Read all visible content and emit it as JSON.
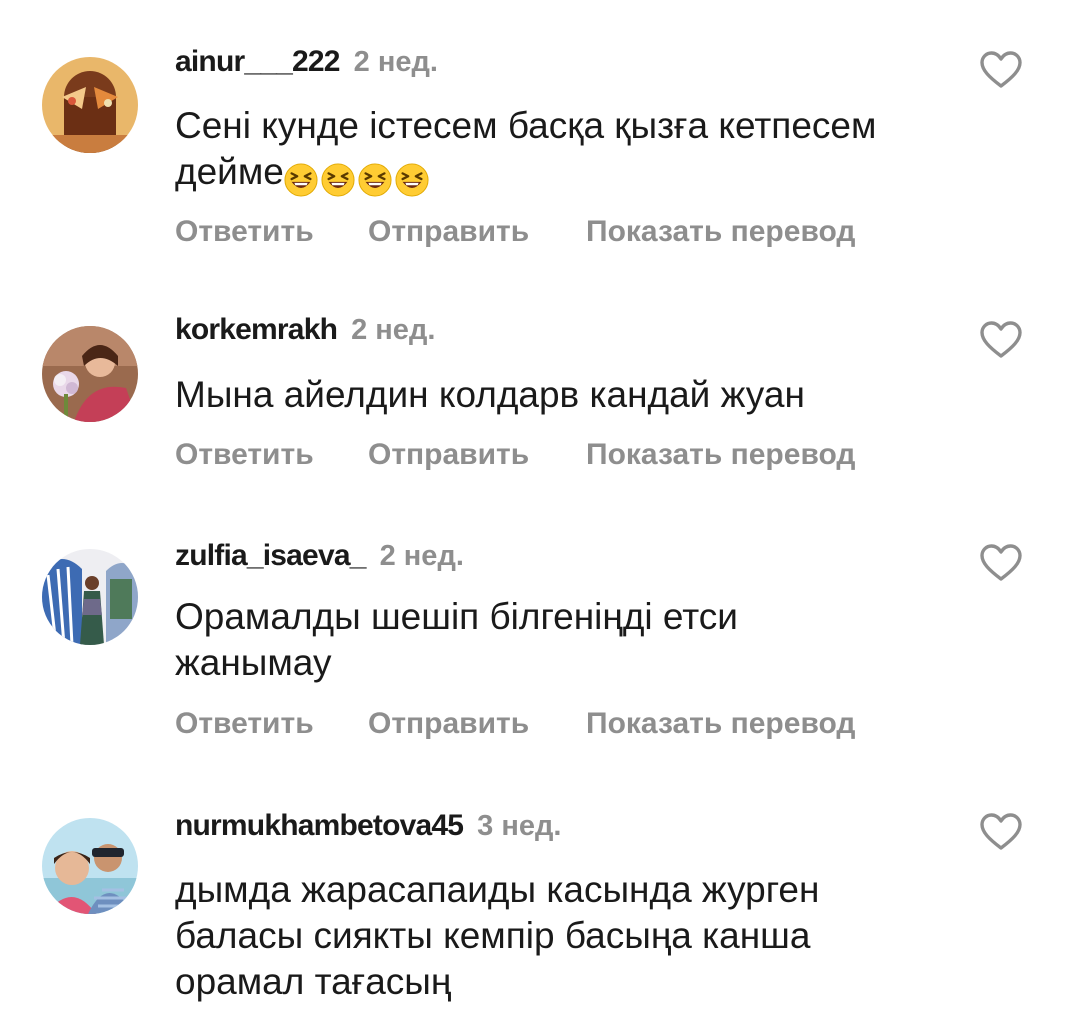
{
  "actions": {
    "reply": "Ответить",
    "send": "Отправить",
    "translate": "Показать перевод"
  },
  "comments": [
    {
      "username": "ainur___222",
      "time": "2 нед.",
      "text": "Сені кунде істесем басқа қызға кетпесем дейме",
      "emoji": "😆😆😆😆"
    },
    {
      "username": "korkemrakh",
      "time": "2 нед.",
      "text": "Мына айелдин колдарв кандай жуан"
    },
    {
      "username": "zulfia_isaeva_",
      "time": "2 нед.",
      "text": "Орамалды шешіп білгеніңді етси жанымау"
    },
    {
      "username": "nurmukhambetova45",
      "time": "3 нед.",
      "text": "дымда жарасапаиды касында журген баласы сиякты кемпір басыңа канша орамал тағасың"
    }
  ],
  "icons": {
    "like": "heart-outline-icon",
    "emoji": "grinning-squinting-face-icon"
  },
  "colors": {
    "text": "#1a1a1a",
    "secondary": "#8e8e8e",
    "background": "#ffffff"
  }
}
